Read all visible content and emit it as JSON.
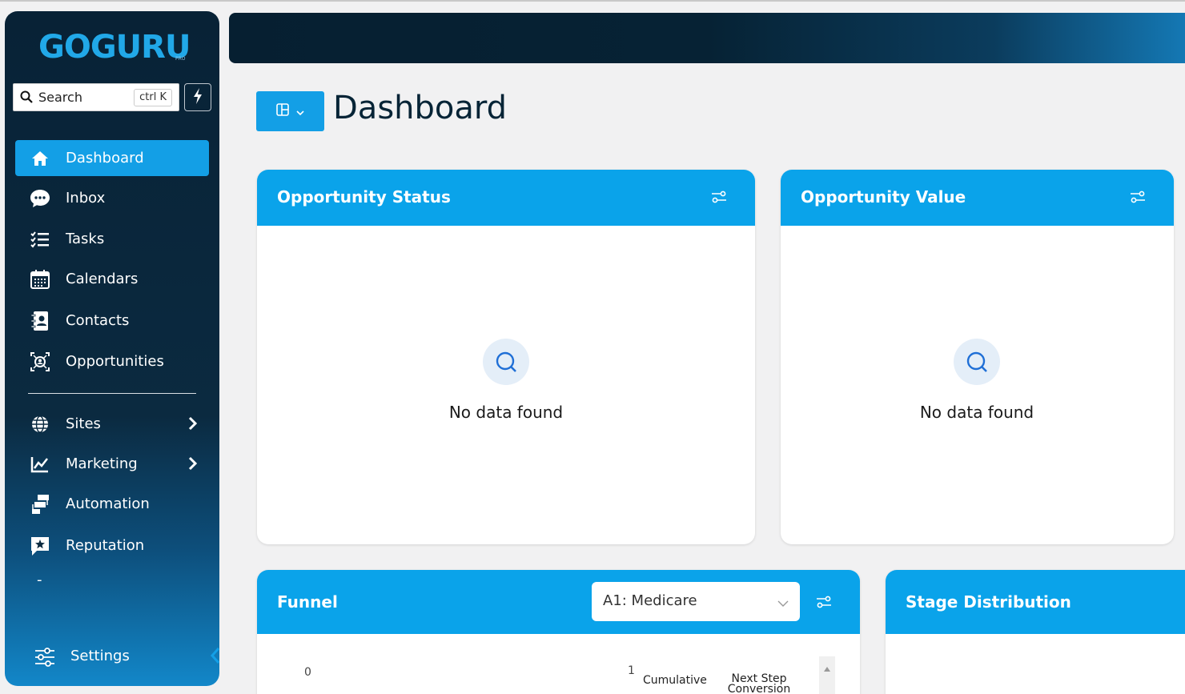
{
  "app": {
    "logo_text": "GOGURU",
    "logo_sub": "PRO"
  },
  "search": {
    "placeholder": "Search",
    "shortcut": "ctrl K"
  },
  "sidebar": {
    "items": [
      {
        "label": "Dashboard",
        "icon": "home-icon",
        "active": true
      },
      {
        "label": "Inbox",
        "icon": "chat-icon"
      },
      {
        "label": "Tasks",
        "icon": "task-list-icon"
      },
      {
        "label": "Calendars",
        "icon": "calendar-icon"
      },
      {
        "label": "Contacts",
        "icon": "contacts-book-icon"
      },
      {
        "label": "Opportunities",
        "icon": "opportunity-icon"
      },
      {
        "label": "Sites",
        "icon": "globe-icon",
        "expandable": true
      },
      {
        "label": "Marketing",
        "icon": "chart-icon",
        "expandable": true
      },
      {
        "label": "Automation",
        "icon": "workflow-icon"
      },
      {
        "label": "Reputation",
        "icon": "star-message-icon"
      }
    ],
    "dash_mark": "-",
    "settings_label": "Settings"
  },
  "page": {
    "title": "Dashboard"
  },
  "widgets": {
    "opportunity_status": {
      "title": "Opportunity Status",
      "empty_text": "No data found"
    },
    "opportunity_value": {
      "title": "Opportunity Value",
      "empty_text": "No data found"
    },
    "funnel": {
      "title": "Funnel",
      "pipeline_selected": "A1: Medicare",
      "axis_start": "0",
      "axis_end": "1",
      "col_cumulative": "Cumulative",
      "col_next_step": "Next Step Conversion"
    },
    "stage_distribution": {
      "title": "Stage Distribution"
    }
  },
  "colors": {
    "accent": "#0aa3ea",
    "sidebar_bg": "#082236",
    "active_item": "#139fe6"
  }
}
